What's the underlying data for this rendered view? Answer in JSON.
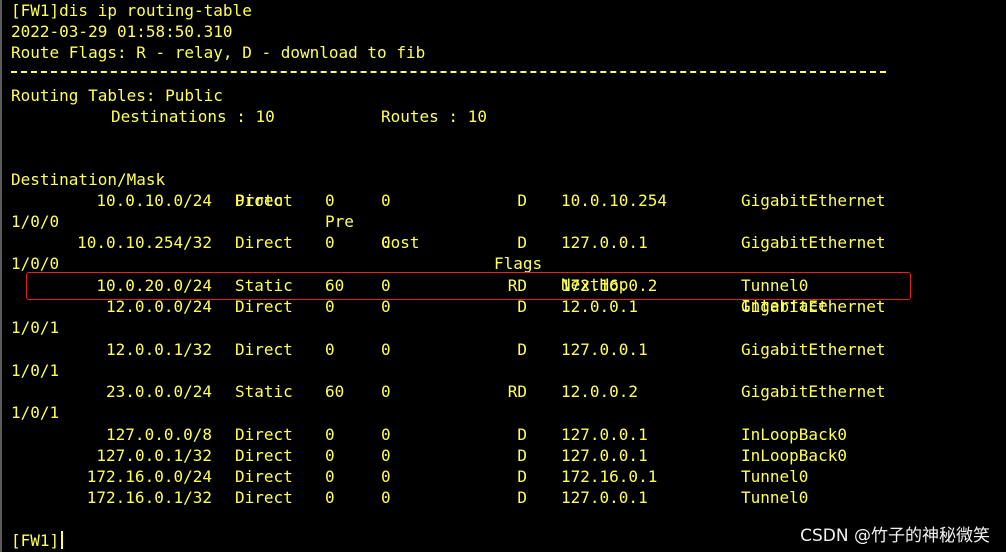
{
  "terminal": {
    "command_line": "[FW1]dis ip routing-table",
    "timestamp": "2022-03-29 01:58:50.310",
    "flags_legend": "Route Flags: R - relay, D - download to fib",
    "tables_title": "Routing Tables: Public",
    "destinations_label": "Destinations : 10",
    "routes_label": "Routes : 10",
    "headers": {
      "destination": "Destination/Mask",
      "proto": "Proto",
      "pre": "Pre",
      "cost": "Cost",
      "flags": "Flags",
      "nexthop": "NextHop",
      "interface": "Interface"
    },
    "routes": [
      {
        "destination": "10.0.10.0/24",
        "proto": "Direct",
        "pre": "0",
        "cost": "0",
        "flags": "D",
        "nexthop": "10.0.10.254",
        "interface": "GigabitEthernet",
        "interface_cont": "1/0/0"
      },
      {
        "destination": "10.0.10.254/32",
        "proto": "Direct",
        "pre": "0",
        "cost": "0",
        "flags": "D",
        "nexthop": "127.0.0.1",
        "interface": "GigabitEthernet",
        "interface_cont": "1/0/0"
      },
      {
        "destination": "10.0.20.0/24",
        "proto": "Static",
        "pre": "60",
        "cost": "0",
        "flags": "RD",
        "nexthop": "172.16.0.2",
        "interface": "Tunnel0"
      },
      {
        "destination": "12.0.0.0/24",
        "proto": "Direct",
        "pre": "0",
        "cost": "0",
        "flags": "D",
        "nexthop": "12.0.0.1",
        "interface": "GigabitEthernet",
        "interface_cont": "1/0/1"
      },
      {
        "destination": "12.0.0.1/32",
        "proto": "Direct",
        "pre": "0",
        "cost": "0",
        "flags": "D",
        "nexthop": "127.0.0.1",
        "interface": "GigabitEthernet",
        "interface_cont": "1/0/1"
      },
      {
        "destination": "23.0.0.0/24",
        "proto": "Static",
        "pre": "60",
        "cost": "0",
        "flags": "RD",
        "nexthop": "12.0.0.2",
        "interface": "GigabitEthernet",
        "interface_cont": "1/0/1"
      },
      {
        "destination": "127.0.0.0/8",
        "proto": "Direct",
        "pre": "0",
        "cost": "0",
        "flags": "D",
        "nexthop": "127.0.0.1",
        "interface": "InLoopBack0"
      },
      {
        "destination": "127.0.0.1/32",
        "proto": "Direct",
        "pre": "0",
        "cost": "0",
        "flags": "D",
        "nexthop": "127.0.0.1",
        "interface": "InLoopBack0"
      },
      {
        "destination": "172.16.0.0/24",
        "proto": "Direct",
        "pre": "0",
        "cost": "0",
        "flags": "D",
        "nexthop": "172.16.0.1",
        "interface": "Tunnel0"
      },
      {
        "destination": "172.16.0.1/32",
        "proto": "Direct",
        "pre": "0",
        "cost": "0",
        "flags": "D",
        "nexthop": "127.0.0.1",
        "interface": "Tunnel0"
      }
    ],
    "prompt": "[FW1]"
  },
  "watermark": "CSDN @竹子的神秘微笑",
  "colors": {
    "background": "#000000",
    "text": "#ffff55",
    "highlight_border": "#e8211c",
    "watermark": "#f2f2f2"
  }
}
